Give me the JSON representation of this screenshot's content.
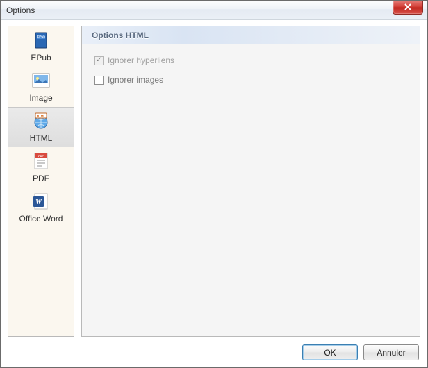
{
  "window": {
    "title": "Options"
  },
  "sidebar": {
    "items": [
      {
        "label": "EPub"
      },
      {
        "label": "Image"
      },
      {
        "label": "HTML"
      },
      {
        "label": "PDF"
      },
      {
        "label": "Office Word"
      }
    ]
  },
  "panel": {
    "title": "Options HTML",
    "options": [
      {
        "label": "Ignorer hyperliens",
        "checked": true,
        "disabled": true
      },
      {
        "label": "Ignorer images",
        "checked": false,
        "disabled": false
      }
    ]
  },
  "buttons": {
    "ok": "OK",
    "cancel": "Annuler"
  },
  "icons": {
    "close": "close-icon",
    "epub": "epub-icon",
    "image": "image-icon",
    "html": "html-icon",
    "pdf": "pdf-icon",
    "word": "word-icon"
  }
}
